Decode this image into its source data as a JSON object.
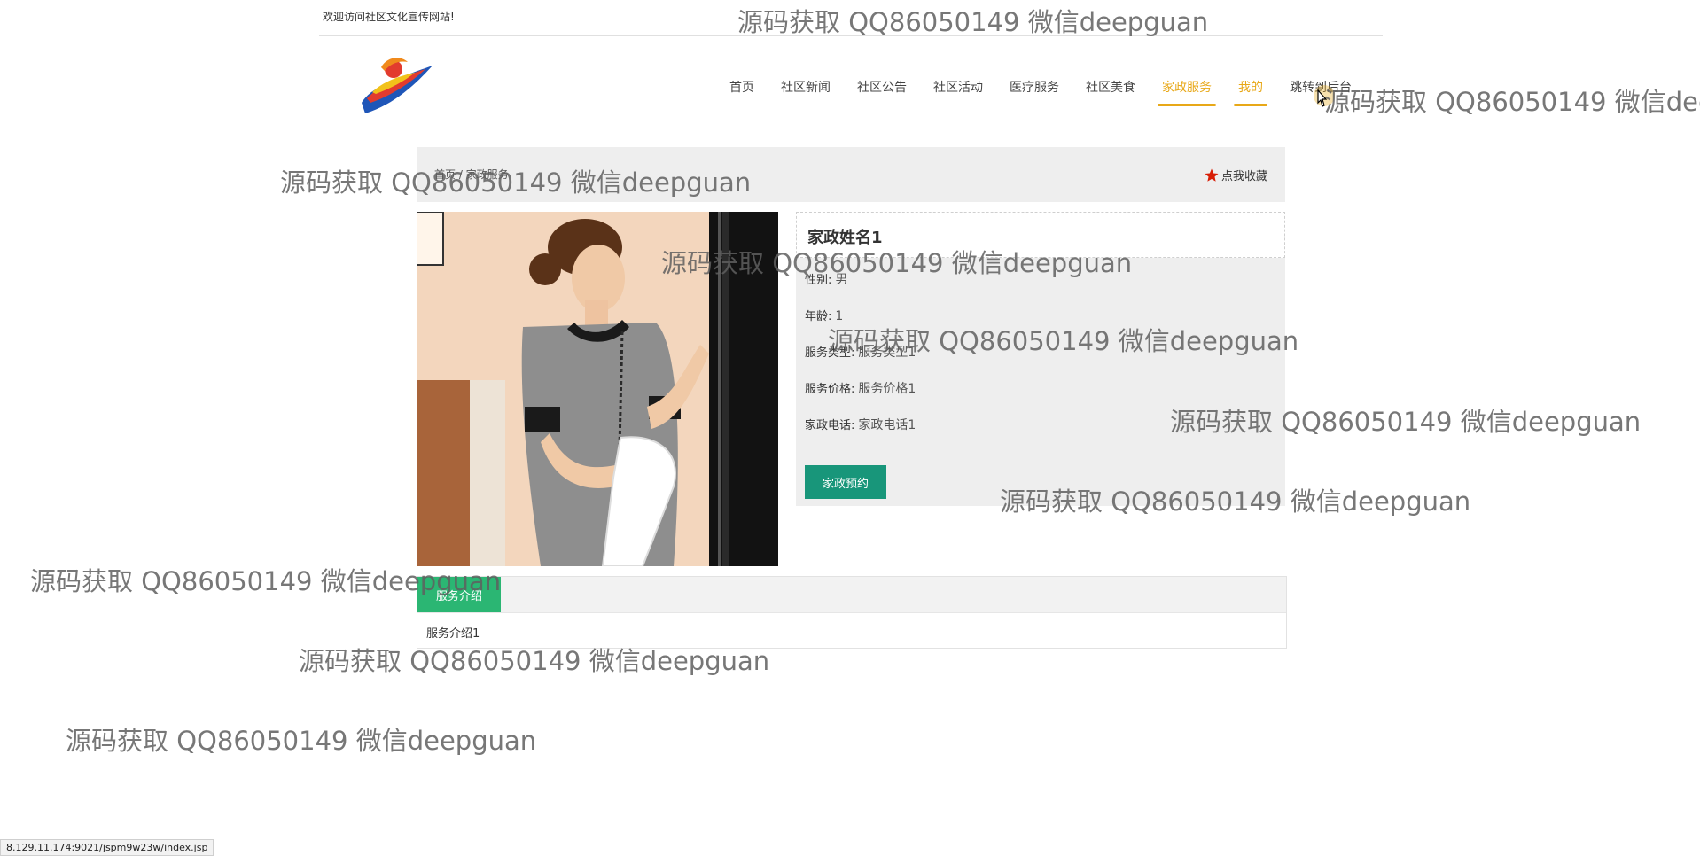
{
  "topbar": {
    "welcome": "欢迎访问社区文化宣传网站!"
  },
  "nav": {
    "items": [
      {
        "label": "首页"
      },
      {
        "label": "社区新闻"
      },
      {
        "label": "社区公告"
      },
      {
        "label": "社区活动"
      },
      {
        "label": "医疗服务"
      },
      {
        "label": "社区美食"
      },
      {
        "label": "家政服务",
        "active": true
      },
      {
        "label": "我的",
        "active": true
      },
      {
        "label": "跳转到后台"
      }
    ]
  },
  "breadcrumb": {
    "text": "首页 / 家政服务"
  },
  "favorite": {
    "label": "点我收藏"
  },
  "detail": {
    "name": "家政姓名1",
    "gender_label": "性别:",
    "gender_value": "男",
    "age_label": "年龄:",
    "age_value": "1",
    "type_label": "服务类型:",
    "type_value": "服务类型1",
    "price_label": "服务价格:",
    "price_value": "服务价格1",
    "phone_label": "家政电话:",
    "phone_value": "家政电话1",
    "book_label": "家政预约"
  },
  "tabs": {
    "intro_label": "服务介绍",
    "intro_content": "服务介绍1"
  },
  "statusbar": {
    "url": "8.129.11.174:9021/jspm9w23w/index.jsp"
  },
  "watermark": {
    "text": "源码获取 QQ86050149 微信deepguan"
  },
  "colors": {
    "accent": "#e8a818",
    "book_button": "#18967a",
    "tab": "#2bb673",
    "star": "#d81e06"
  }
}
